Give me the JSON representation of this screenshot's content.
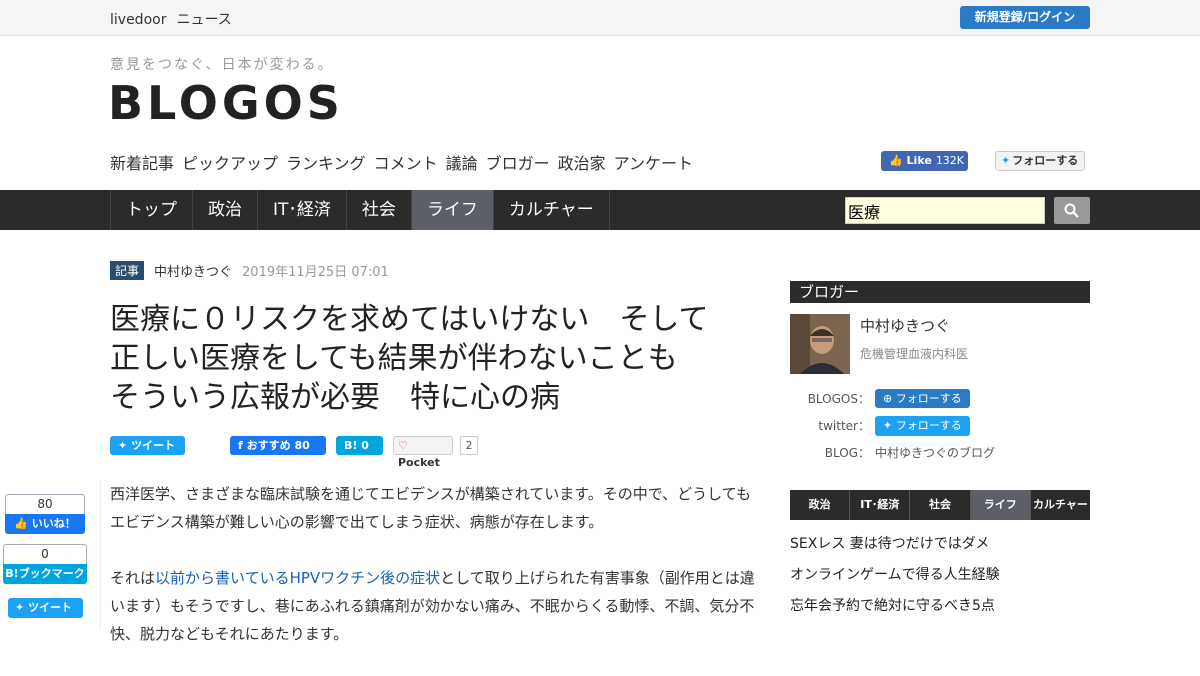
{
  "topbar": {
    "brand1": "livedoor",
    "brand2": "ニュース",
    "login": "新規登録/ログイン"
  },
  "header": {
    "tagline": "意見をつなぐ、日本が変わる。",
    "logo": "BLOGOS",
    "subnav": [
      "新着記事",
      "ピックアップ",
      "ランキング",
      "コメント",
      "議論",
      "ブロガー",
      "政治家",
      "アンケート"
    ],
    "fb_like": "Like",
    "fb_like_count": "132K",
    "tw_follow": "フォローする"
  },
  "categories": {
    "items": [
      "トップ",
      "政治",
      "IT･経済",
      "社会",
      "ライフ",
      "カルチャー"
    ],
    "active": "ライフ"
  },
  "search": {
    "value": "医療"
  },
  "article": {
    "tag": "記事",
    "author": "中村ゆきつぐ",
    "date": "2019年11月25日 07:01",
    "title_lines": [
      "医療に０リスクを求めてはいけない　そして",
      "正しい医療をしても結果が伴わないことも",
      "そういう広報が必要　特に心の病"
    ],
    "share": {
      "tweet": "ツイート",
      "fb": "おすすめ 80",
      "hatena": "B! 0",
      "pocket": "Pocket",
      "pocket_count": "2"
    },
    "para1": "西洋医学、さまざまな臨床試験を通じてエビデンスが構築されています。その中で、どうしてもエビデンス構築が難しい心の影響で出てしまう症状、病態が存在します。",
    "para2_pre": "それは",
    "para2_link": "以前から書いているHPVワクチン後の症状",
    "para2_post": "として取り上げられた有害事象（副作用とは違います）もそうですし、巷にあふれる鎮痛剤が効かない痛み、不眠からくる動悸、不調、気分不快、脱力などもそれにあたります。"
  },
  "floating": {
    "fb_count": "80",
    "fb_label": "いいね！",
    "hb_count": "0",
    "hb_label": "B!ブックマーク",
    "tw_label": "ツイート"
  },
  "sidebar": {
    "heading": "ブロガー",
    "name": "中村ゆきつぐ",
    "role": "危機管理血液内科医",
    "blogos_key": "BLOGOS：",
    "blogos_btn": "フォローする",
    "twitter_key": "twitter：",
    "twitter_btn": "フォローする",
    "blog_key": "BLOG：",
    "blog_val": "中村ゆきつぐのブログ",
    "cats": [
      "政治",
      "IT･経済",
      "社会",
      "ライフ",
      "カルチャー"
    ],
    "active_cat": "ライフ",
    "list": [
      "SEXレス 妻は待つだけではダメ",
      "オンラインゲームで得る人生経験",
      "忘年会予約で絶対に守るべき5点"
    ]
  },
  "colors": {
    "accent": "#2a7ac6",
    "dark": "#2b2b2b",
    "active": "#5c5f66",
    "search_bg": "#ffffdd"
  }
}
